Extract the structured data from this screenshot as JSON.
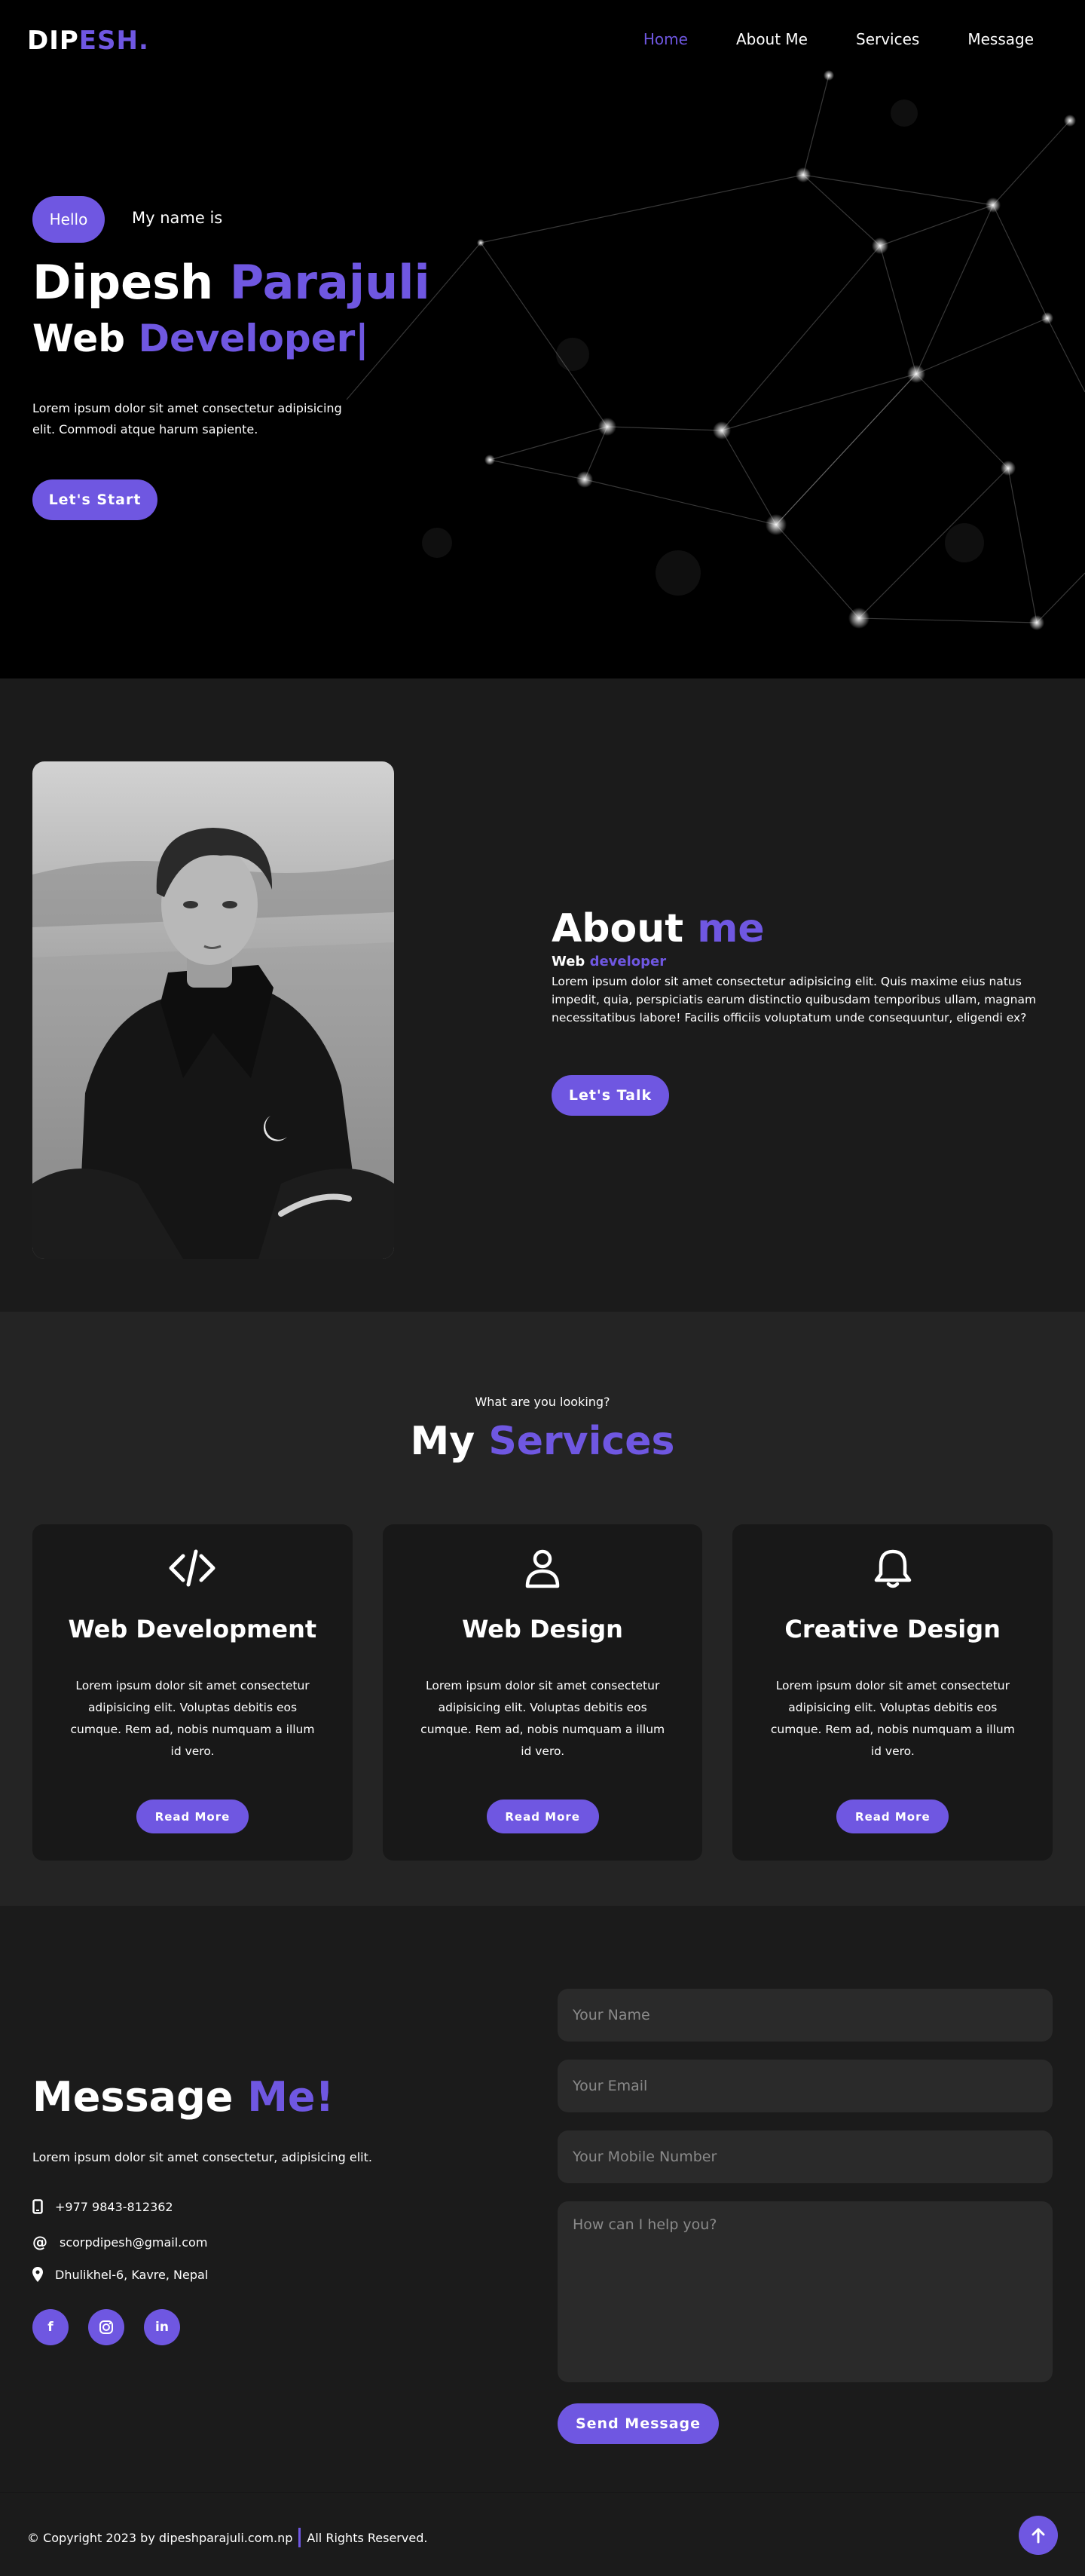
{
  "colors": {
    "accent": "#6f57e1",
    "hero_bg": "#000000",
    "section_dark": "#1b1b1b",
    "section_mid": "#242424",
    "card_bg": "#181818",
    "input_bg": "#2a2a2a"
  },
  "nav": {
    "logo_a": "DIP",
    "logo_b": "ESH.",
    "links": [
      "Home",
      "About Me",
      "Services",
      "Message"
    ],
    "active": "Home"
  },
  "hero": {
    "hello": "Hello",
    "my_name": "My name is",
    "first_name": "Dipesh",
    "last_name": "Parajuli",
    "role_a": "Web",
    "role_b": "Developer|",
    "text": "Lorem ipsum dolor sit amet consectetur adipisicing elit. Commodi atque harum sapiente.",
    "button": "Let's Start"
  },
  "about": {
    "title_a": "About",
    "title_b": "me",
    "sub_a": "Web",
    "sub_b": "developer",
    "text": "Lorem ipsum dolor sit amet consectetur adipisicing elit. Quis maxime eius natus impedit, quia, perspiciatis earum distinctio quibusdam temporibus ullam, magnam necessitatibus labore! Facilis officiis voluptatum unde consequuntur, eligendi ex?",
    "button": "Let's Talk"
  },
  "services": {
    "kicker": "What are you looking?",
    "title_a": "My",
    "title_b": "Services",
    "cards": [
      {
        "icon": "code-icon",
        "title": "Web Development",
        "text": "Lorem ipsum dolor sit amet consectetur adipisicing elit. Voluptas debitis eos cumque. Rem ad, nobis numquam a illum id vero.",
        "button": "Read More"
      },
      {
        "icon": "user-icon",
        "title": "Web Design",
        "text": "Lorem ipsum dolor sit amet consectetur adipisicing elit. Voluptas debitis eos cumque. Rem ad, nobis numquam a illum id vero.",
        "button": "Read More"
      },
      {
        "icon": "bell-icon",
        "title": "Creative Design",
        "text": "Lorem ipsum dolor sit amet consectetur adipisicing elit. Voluptas debitis eos cumque. Rem ad, nobis numquam a illum id vero.",
        "button": "Read More"
      }
    ]
  },
  "contact": {
    "title_a": "Message",
    "title_b": "Me!",
    "text": "Lorem ipsum dolor sit amet consectetur, adipisicing elit.",
    "phone": "+977 9843-812362",
    "email": "scorpdipesh@gmail.com",
    "address": "Dhulikhel-6, Kavre, Nepal",
    "socials": [
      "f",
      "ig",
      "in"
    ],
    "placeholders": {
      "name": "Your Name",
      "email": "Your Email",
      "mobile": "Your Mobile Number",
      "message": "How can I help you?"
    },
    "button": "Send Message"
  },
  "footer": {
    "copyright": "© Copyright 2023 by dipeshparajuli.com.np",
    "rights": "All Rights Reserved."
  }
}
